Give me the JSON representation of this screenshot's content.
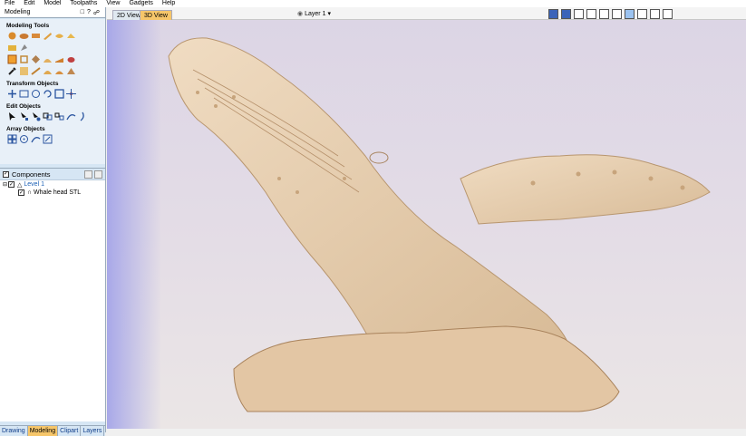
{
  "menu": [
    "File",
    "Edit",
    "Model",
    "Toolpaths",
    "View",
    "Gadgets",
    "Help"
  ],
  "panel": {
    "title": "Modeling",
    "help": "?"
  },
  "sections": [
    {
      "title": "Modeling Tools",
      "rows": [
        [
          "shape-icon",
          "tool-icon",
          "tool-icon",
          "tool-icon",
          "tool-icon",
          "tool-icon"
        ],
        [
          "tool-icon",
          "tool-icon"
        ],
        [
          "tool-icon",
          "tool-icon",
          "tool-icon",
          "tool-icon",
          "tool-icon",
          "tool-icon"
        ],
        [
          "tool-icon",
          "tool-icon",
          "tool-icon",
          "tool-icon",
          "tool-icon",
          "tool-icon"
        ]
      ]
    },
    {
      "title": "Transform Objects",
      "rows": [
        [
          "tool-icon",
          "tool-icon",
          "tool-icon",
          "tool-icon",
          "tool-icon",
          "tool-icon"
        ]
      ]
    },
    {
      "title": "Edit Objects",
      "rows": [
        [
          "tool-icon",
          "tool-icon",
          "tool-icon",
          "tool-icon",
          "tool-icon",
          "tool-icon",
          "tool-icon"
        ]
      ]
    },
    {
      "title": "Array Objects",
      "rows": [
        [
          "tool-icon",
          "tool-icon",
          "tool-icon",
          "tool-icon"
        ]
      ]
    }
  ],
  "components": {
    "title": "Components",
    "level": "Level 1",
    "item": "Whale head STL"
  },
  "bottom_tabs": [
    "Drawing",
    "Modeling",
    "Clipart",
    "Layers"
  ],
  "view_tabs": [
    "2D View",
    "3D View"
  ],
  "layer": {
    "label": "Layer 1"
  },
  "colors": {
    "accent_tab": "#f6c66a",
    "panel_bg": "#d6e6f4",
    "model": "#e9d2b6"
  }
}
